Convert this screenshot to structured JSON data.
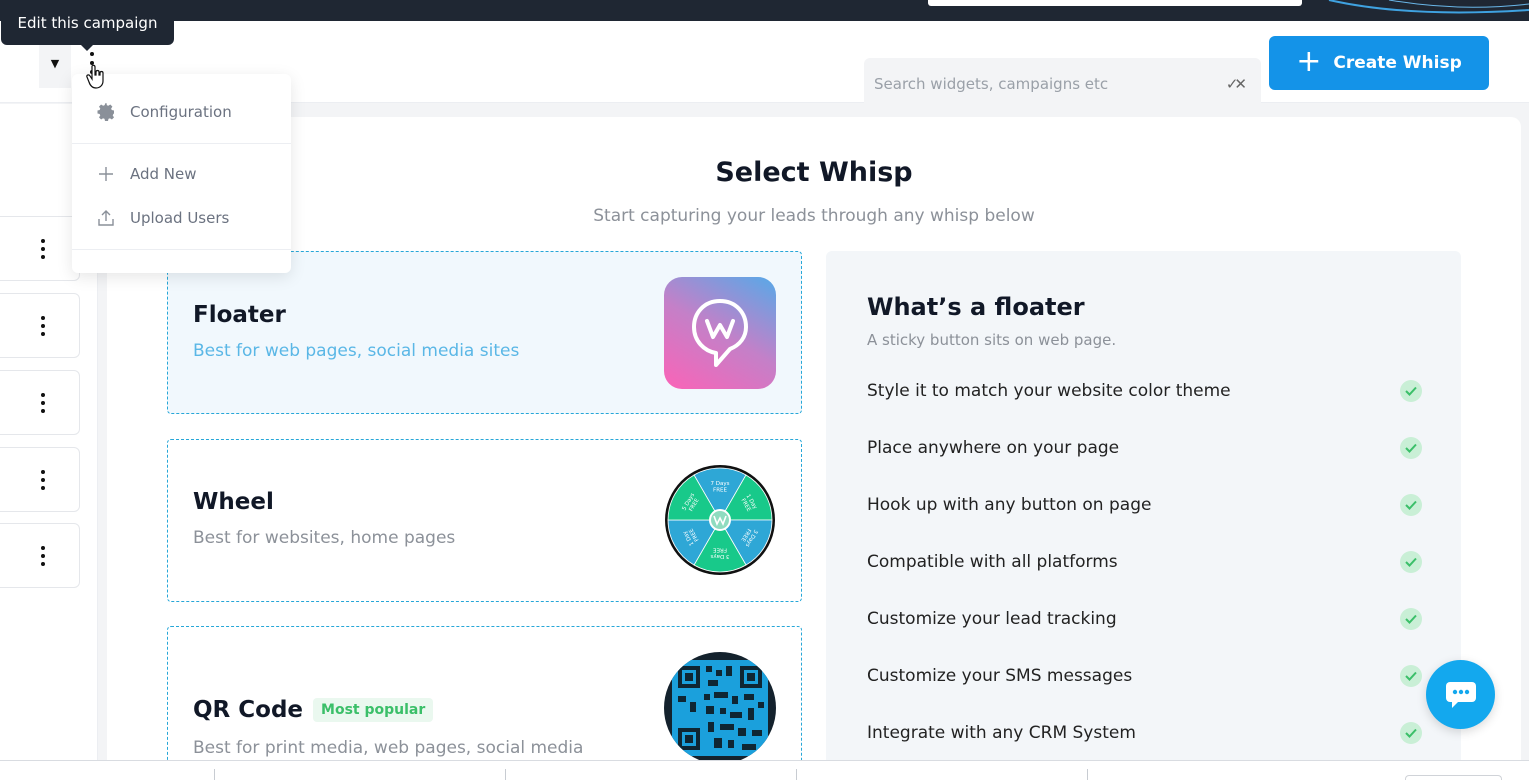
{
  "tooltip": {
    "text": "Edit this campaign"
  },
  "header": {
    "search_placeholder": "Search widgets, campaigns etc",
    "create_label": "Create Whisp"
  },
  "menu": {
    "items": [
      {
        "label": "Configuration",
        "icon": "gear-icon"
      },
      {
        "label": "Add New",
        "icon": "plus-icon"
      },
      {
        "label": "Upload Users",
        "icon": "upload-icon"
      }
    ]
  },
  "main": {
    "title": "Select Whisp",
    "subtitle": "Start capturing your leads through any whisp below"
  },
  "cards": [
    {
      "title": "Floater",
      "desc": "Best for web pages, social media sites",
      "selected": true
    },
    {
      "title": "Wheel",
      "desc": "Best for websites, home pages"
    },
    {
      "title": "QR Code",
      "badge": "Most popular",
      "desc": "Best for print media, web pages, social media"
    }
  ],
  "wheel_segments": [
    "7 Days FREE",
    "1 Day FREE",
    "3 Days FREE",
    "3 Days FREE",
    "1 Day FREE",
    "5 Days FREE"
  ],
  "info": {
    "title": "What’s a floater",
    "subtitle": "A sticky button sits on web page.",
    "features": [
      "Style it to match your website color theme",
      "Place anywhere on your page",
      "Hook up with any button on page",
      "Compatible with all platforms",
      "Customize your lead tracking",
      "Customize your SMS messages",
      "Integrate with any CRM System"
    ]
  },
  "colors": {
    "primary": "#1493e8",
    "check_green": "#3bbf69",
    "dashed_border": "#27a7d8",
    "tooltip_bg": "#1f2733"
  }
}
